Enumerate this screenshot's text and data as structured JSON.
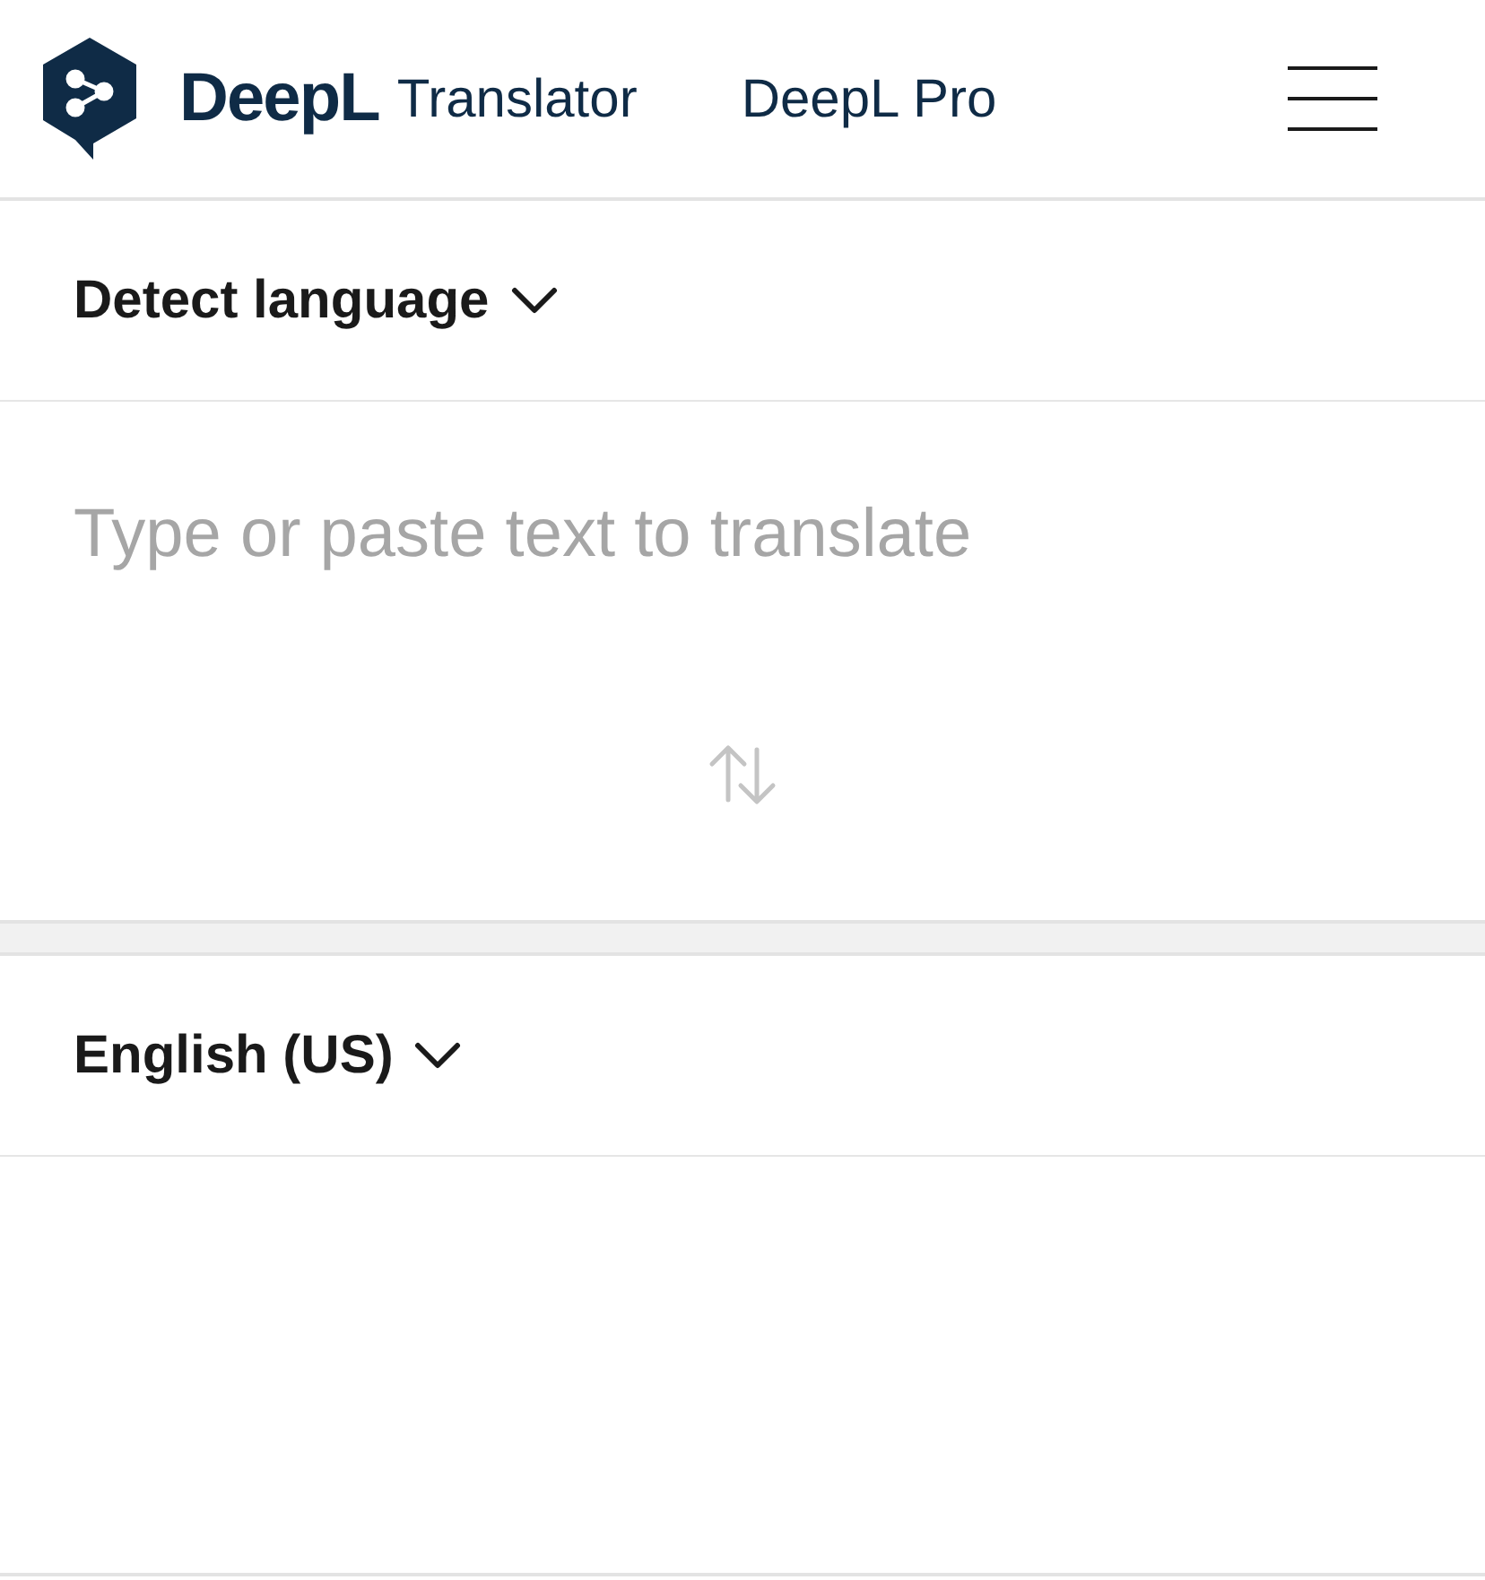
{
  "header": {
    "brand": "DeepL",
    "product": "Translator",
    "pro_link": "DeepL Pro"
  },
  "source": {
    "language": "Detect language",
    "placeholder": "Type or paste text to translate"
  },
  "target": {
    "language": "English (US)"
  }
}
